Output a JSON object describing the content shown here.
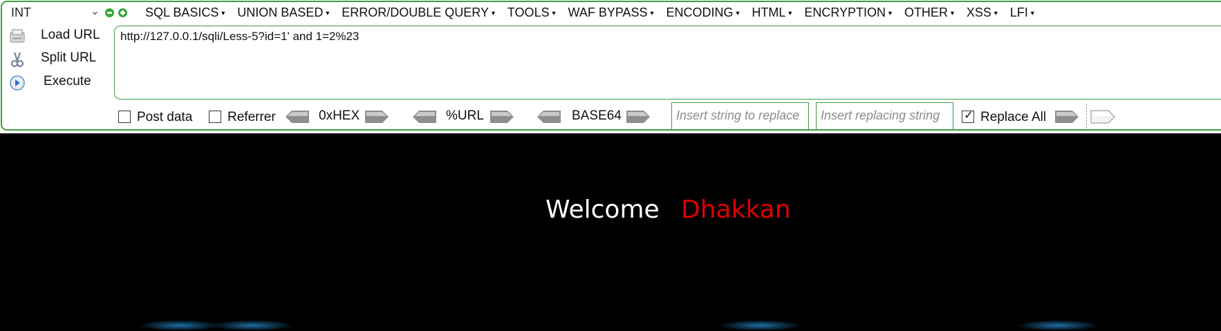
{
  "toolbar": {
    "version_select": "INT",
    "menu": [
      {
        "label": "SQL BASICS"
      },
      {
        "label": "UNION BASED"
      },
      {
        "label": "ERROR/DOUBLE QUERY"
      },
      {
        "label": "TOOLS"
      },
      {
        "label": "WAF BYPASS"
      },
      {
        "label": "ENCODING"
      },
      {
        "label": "HTML"
      },
      {
        "label": "ENCRYPTION"
      },
      {
        "label": "OTHER"
      },
      {
        "label": "XSS"
      },
      {
        "label": "LFI"
      }
    ],
    "actions": {
      "load_url": "Load URL",
      "split_url": "Split URL",
      "execute": "Execute"
    },
    "url": "http://127.0.0.1/sqli/Less-5?id=1' and 1=2%23",
    "post_data_label": "Post data",
    "referrer_label": "Referrer",
    "hex_label": "0xHEX",
    "url_label": "%URL",
    "base64_label": "BASE64",
    "replace_placeholder": "Insert string to replace",
    "replacing_placeholder": "Insert replacing string",
    "replace_all_label": "Replace All",
    "post_data_checked": false,
    "referrer_checked": false,
    "replace_all_checked": true
  },
  "page": {
    "welcome": "Welcome",
    "name": "Dhakkan",
    "name_color": "#e00000"
  },
  "colors": {
    "accent_border": "#3c9e3c",
    "page_bg": "#000000"
  }
}
